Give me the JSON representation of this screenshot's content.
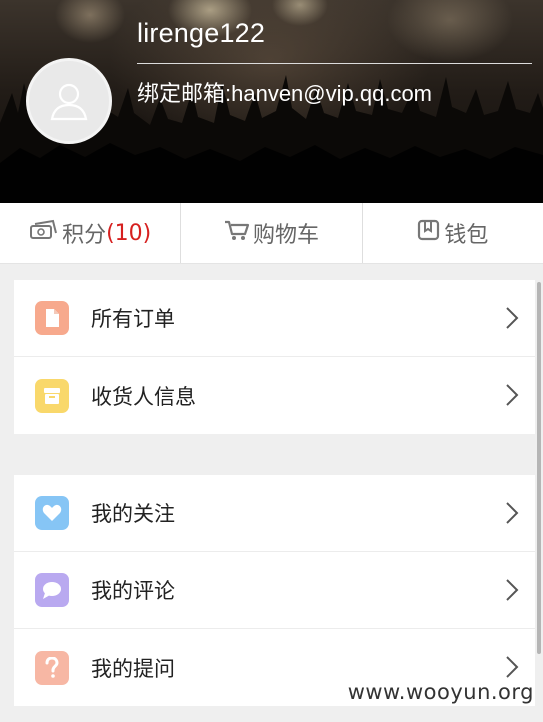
{
  "profile": {
    "username": "lirenge122",
    "email": "绑定邮箱:hanven@vip.qq.com"
  },
  "stats": {
    "points_label": "积分",
    "points_count": "(10)",
    "cart_label": "购物车",
    "wallet_label": "钱包",
    "points_icon": "coins-icon",
    "cart_icon": "cart-icon",
    "wallet_icon": "wallet-icon"
  },
  "group1": [
    {
      "label": "所有订单",
      "icon": "document-icon",
      "color": "#f7a98d"
    },
    {
      "label": "收货人信息",
      "icon": "archive-box-icon",
      "color": "#f9d86b"
    }
  ],
  "group2": [
    {
      "label": "我的关注",
      "icon": "heart-icon",
      "color": "#86c5f5"
    },
    {
      "label": "我的评论",
      "icon": "chat-bubble-icon",
      "color": "#b9a9f0"
    },
    {
      "label": "我的提问",
      "icon": "question-icon",
      "color": "#f7b7a4"
    }
  ],
  "watermark": "www.wooyun.org",
  "colors": {
    "accent_red": "#d6201f",
    "background": "#efefef"
  }
}
